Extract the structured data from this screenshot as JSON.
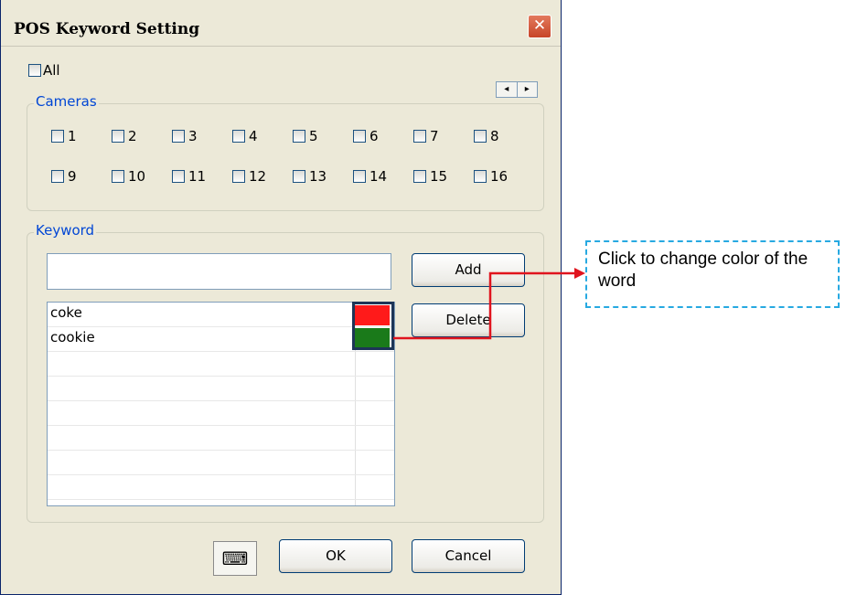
{
  "dialog": {
    "title": "POS Keyword Setting",
    "close_glyph": "✕"
  },
  "all_checkbox": {
    "label": "All",
    "checked": false
  },
  "cameras": {
    "legend": "Cameras",
    "nav_left": "◂",
    "nav_right": "▸",
    "items": [
      "1",
      "2",
      "3",
      "4",
      "5",
      "6",
      "7",
      "8",
      "9",
      "10",
      "11",
      "12",
      "13",
      "14",
      "15",
      "16"
    ]
  },
  "keyword": {
    "legend": "Keyword",
    "input_value": "",
    "add_label": "Add",
    "delete_label": "Delete",
    "rows": [
      {
        "word": "coke",
        "color": "#ff1a1a"
      },
      {
        "word": "cookie",
        "color": "#1a7a1a"
      },
      {
        "word": "",
        "color": ""
      },
      {
        "word": "",
        "color": ""
      },
      {
        "word": "",
        "color": ""
      },
      {
        "word": "",
        "color": ""
      },
      {
        "word": "",
        "color": ""
      },
      {
        "word": "",
        "color": ""
      }
    ]
  },
  "footer": {
    "keyboard_icon": "keyboard-icon",
    "ok_label": "OK",
    "cancel_label": "Cancel"
  },
  "annotation": {
    "text": "Click to change color of the word",
    "line_color": "#e0141e",
    "box_color": "#27a9e1"
  }
}
